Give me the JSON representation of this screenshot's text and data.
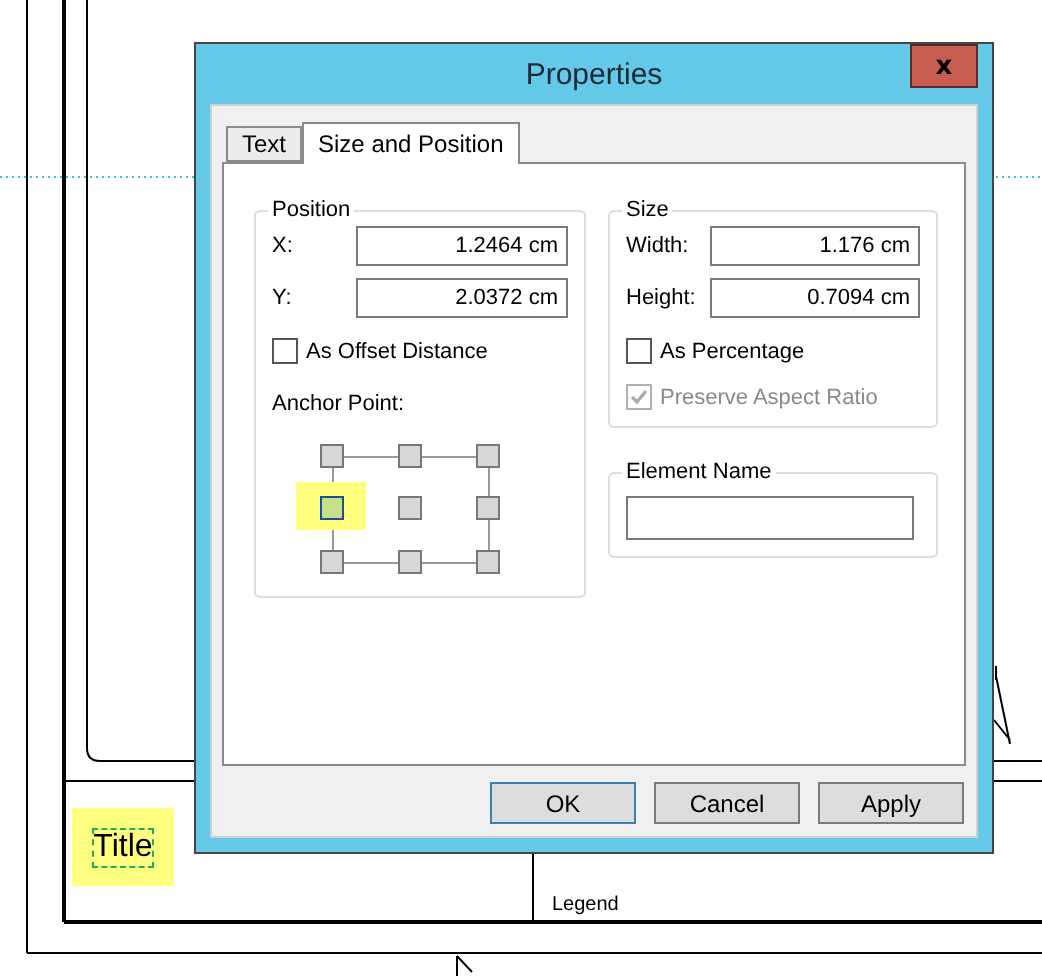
{
  "canvas": {
    "title_label": "Title",
    "legend_label": "Legend"
  },
  "dialog": {
    "title": "Properties",
    "close": "x",
    "tabs": [
      {
        "label": "Text",
        "selected": false
      },
      {
        "label": "Size and Position",
        "selected": true
      }
    ],
    "position": {
      "label": "Position",
      "fields": [
        {
          "label": "X:",
          "value": "1.2464 cm"
        },
        {
          "label": "Y:",
          "value": "2.0372 cm"
        }
      ],
      "offset": {
        "label": "As Offset Distance",
        "checked": false,
        "disabled": false
      },
      "anchor": {
        "label": "Anchor Point:",
        "points": [
          {
            "selected": false
          },
          {
            "selected": false
          },
          {
            "selected": false
          },
          {
            "selected": true
          },
          {
            "selected": false
          },
          {
            "selected": false
          },
          {
            "selected": false
          },
          {
            "selected": false
          },
          {
            "selected": false
          }
        ]
      }
    },
    "size": {
      "label": "Size",
      "fields": [
        {
          "label": "Width:",
          "value": "1.176 cm"
        },
        {
          "label": "Height:",
          "value": "0.7094 cm"
        }
      ],
      "checkboxes": [
        {
          "label": "As Percentage",
          "checked": false,
          "disabled": false
        },
        {
          "label": "Preserve Aspect Ratio",
          "checked": true,
          "disabled": true
        }
      ]
    },
    "element_name": {
      "label": "Element Name"
    },
    "buttons": [
      {
        "label": "OK",
        "default": true
      },
      {
        "label": "Cancel",
        "default": false
      },
      {
        "label": "Apply",
        "default": false
      }
    ]
  }
}
